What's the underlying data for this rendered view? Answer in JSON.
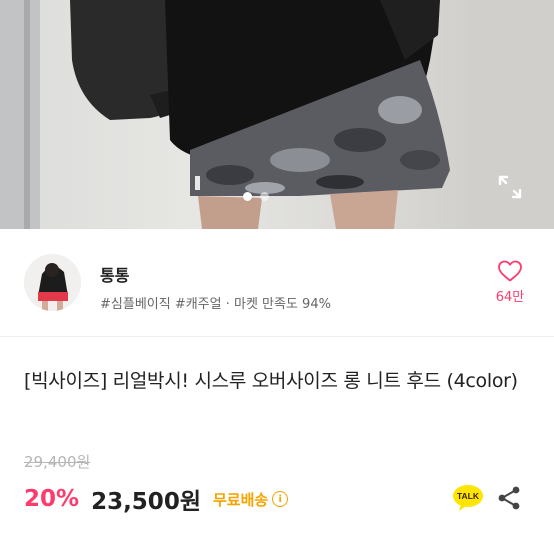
{
  "gallery": {
    "current_index": 1,
    "total": 2,
    "expand_icon": "expand-icon"
  },
  "seller": {
    "avatar_icon": "avatar",
    "shop_name": "통통",
    "meta": "#심플베이직 #캐주얼 · 마켓 만족도 94%",
    "like_icon": "heart-icon",
    "like_count": "64만"
  },
  "product": {
    "title": "[빅사이즈] 리얼박시! 시스루 오버사이즈 롱 니트 후드 (4color)",
    "original_price": "29,400원",
    "discount": "20%",
    "sale_price": "23,500원",
    "shipping": "무료배송",
    "info_icon": "info-icon"
  },
  "actions": {
    "talk_label": "TALK",
    "talk_icon": "kakao-talk-icon",
    "share_icon": "share-icon"
  },
  "colors": {
    "accent_pink": "#ff3b6e",
    "shipping_orange": "#f5a400",
    "talk_yellow": "#fee500"
  }
}
